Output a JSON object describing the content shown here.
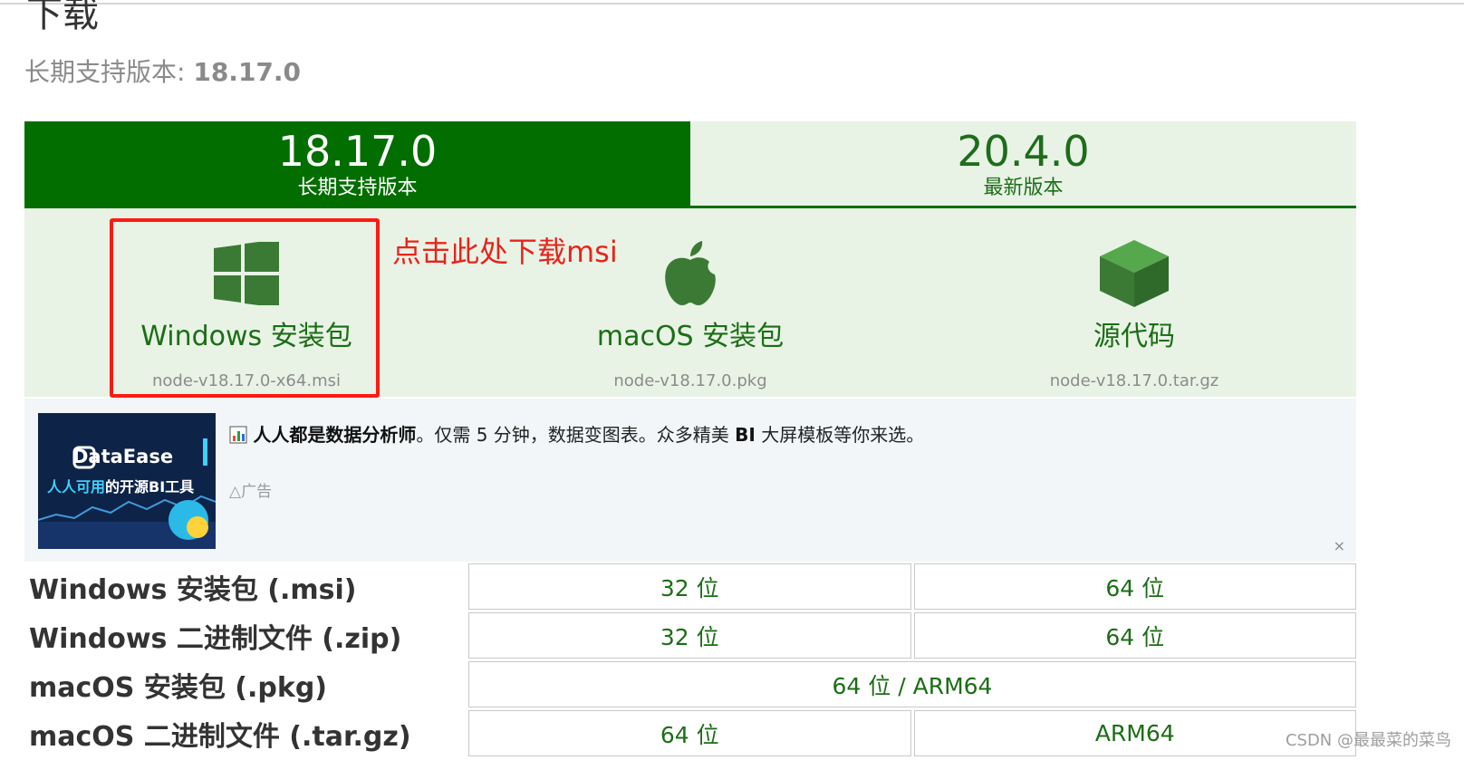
{
  "page_title": "下载",
  "lts": {
    "label": "长期支持版本:",
    "version": "18.17.0"
  },
  "version_tabs": [
    {
      "version": "18.17.0",
      "label": "长期支持版本"
    },
    {
      "version": "20.4.0",
      "label": "最新版本"
    }
  ],
  "downloads": [
    {
      "icon": "windows-icon",
      "label": "Windows 安装包",
      "file": "node-v18.17.0-x64.msi"
    },
    {
      "icon": "apple-icon",
      "label": "macOS 安装包",
      "file": "node-v18.17.0.pkg"
    },
    {
      "icon": "cube-icon",
      "label": "源代码",
      "file": "node-v18.17.0.tar.gz"
    }
  ],
  "annotation": "点击此处下载msi",
  "ad": {
    "brand": "DataEase",
    "sub_accent": "人人可用",
    "sub_rest": "的开源BI工具",
    "headline": "人人都是数据分析师",
    "text_a": "。仅需 5 分钟，数据变图表。众多精美 ",
    "text_bi": "BI",
    "text_b": " 大屏模板等你来选。",
    "tag": "广告",
    "close": "×"
  },
  "table": {
    "rows": [
      {
        "label": "Windows 安装包 (.msi)",
        "cells": [
          "32 位",
          "64 位"
        ]
      },
      {
        "label": "Windows 二进制文件 (.zip)",
        "cells": [
          "32 位",
          "64 位"
        ]
      },
      {
        "label": "macOS 安装包 (.pkg)",
        "cells": [
          "64 位 / ARM64"
        ]
      },
      {
        "label": "macOS 二进制文件 (.tar.gz)",
        "cells": [
          "64 位",
          "ARM64"
        ]
      }
    ]
  },
  "watermark": "CSDN @最最菜的菜鸟",
  "colors": {
    "brand_green": "#026e00",
    "light_green": "#e8f3e5",
    "annotation_red": "#e8231b"
  }
}
